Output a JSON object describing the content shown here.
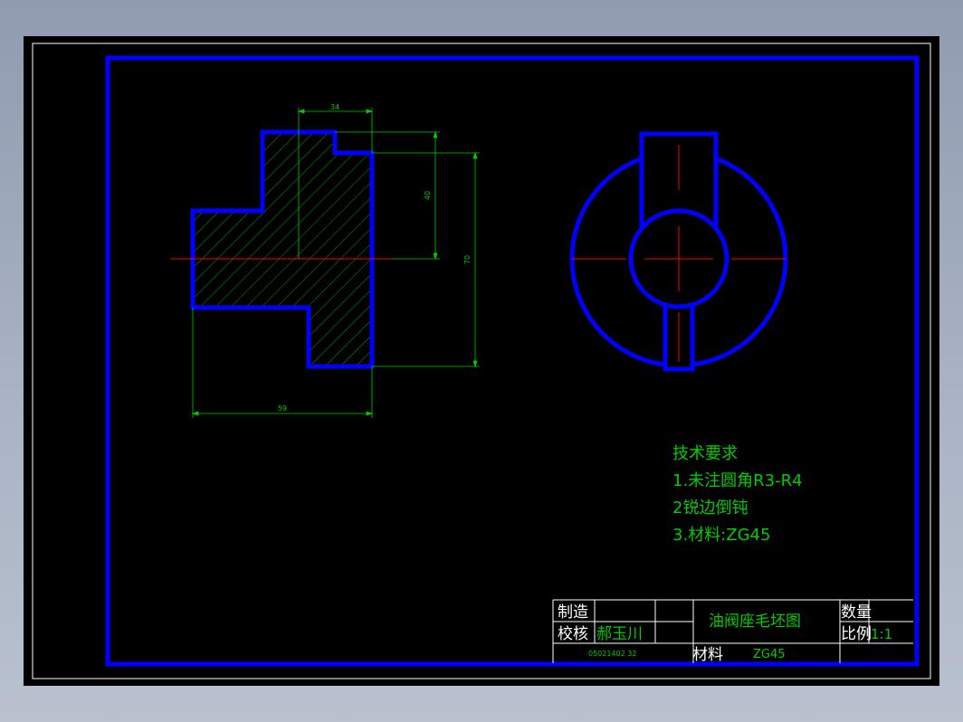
{
  "dimensions": {
    "width_34": "34",
    "height_40": "40",
    "height_70": "70",
    "width_59": "59"
  },
  "notes": {
    "heading": "技术要求",
    "line1": "1.未注圆角R3-R4",
    "line2": "2锐边倒钝",
    "line3": "3.材料:ZG45"
  },
  "title_block": {
    "make_label": "制造",
    "check_label": "校核",
    "checker_name": "郝玉川",
    "student_id": "05021402 32",
    "drawing_title": "油阀座毛坯图",
    "quantity_label": "数量",
    "scale_label": "比例",
    "scale_value": "1:1",
    "material_label": "材料",
    "material_value": "ZG45"
  },
  "colors": {
    "outline": "#0000ff",
    "dimension": "#00cc00",
    "centerline": "#ff0000",
    "hatch": "#00cc00",
    "sheet": "#000000"
  }
}
